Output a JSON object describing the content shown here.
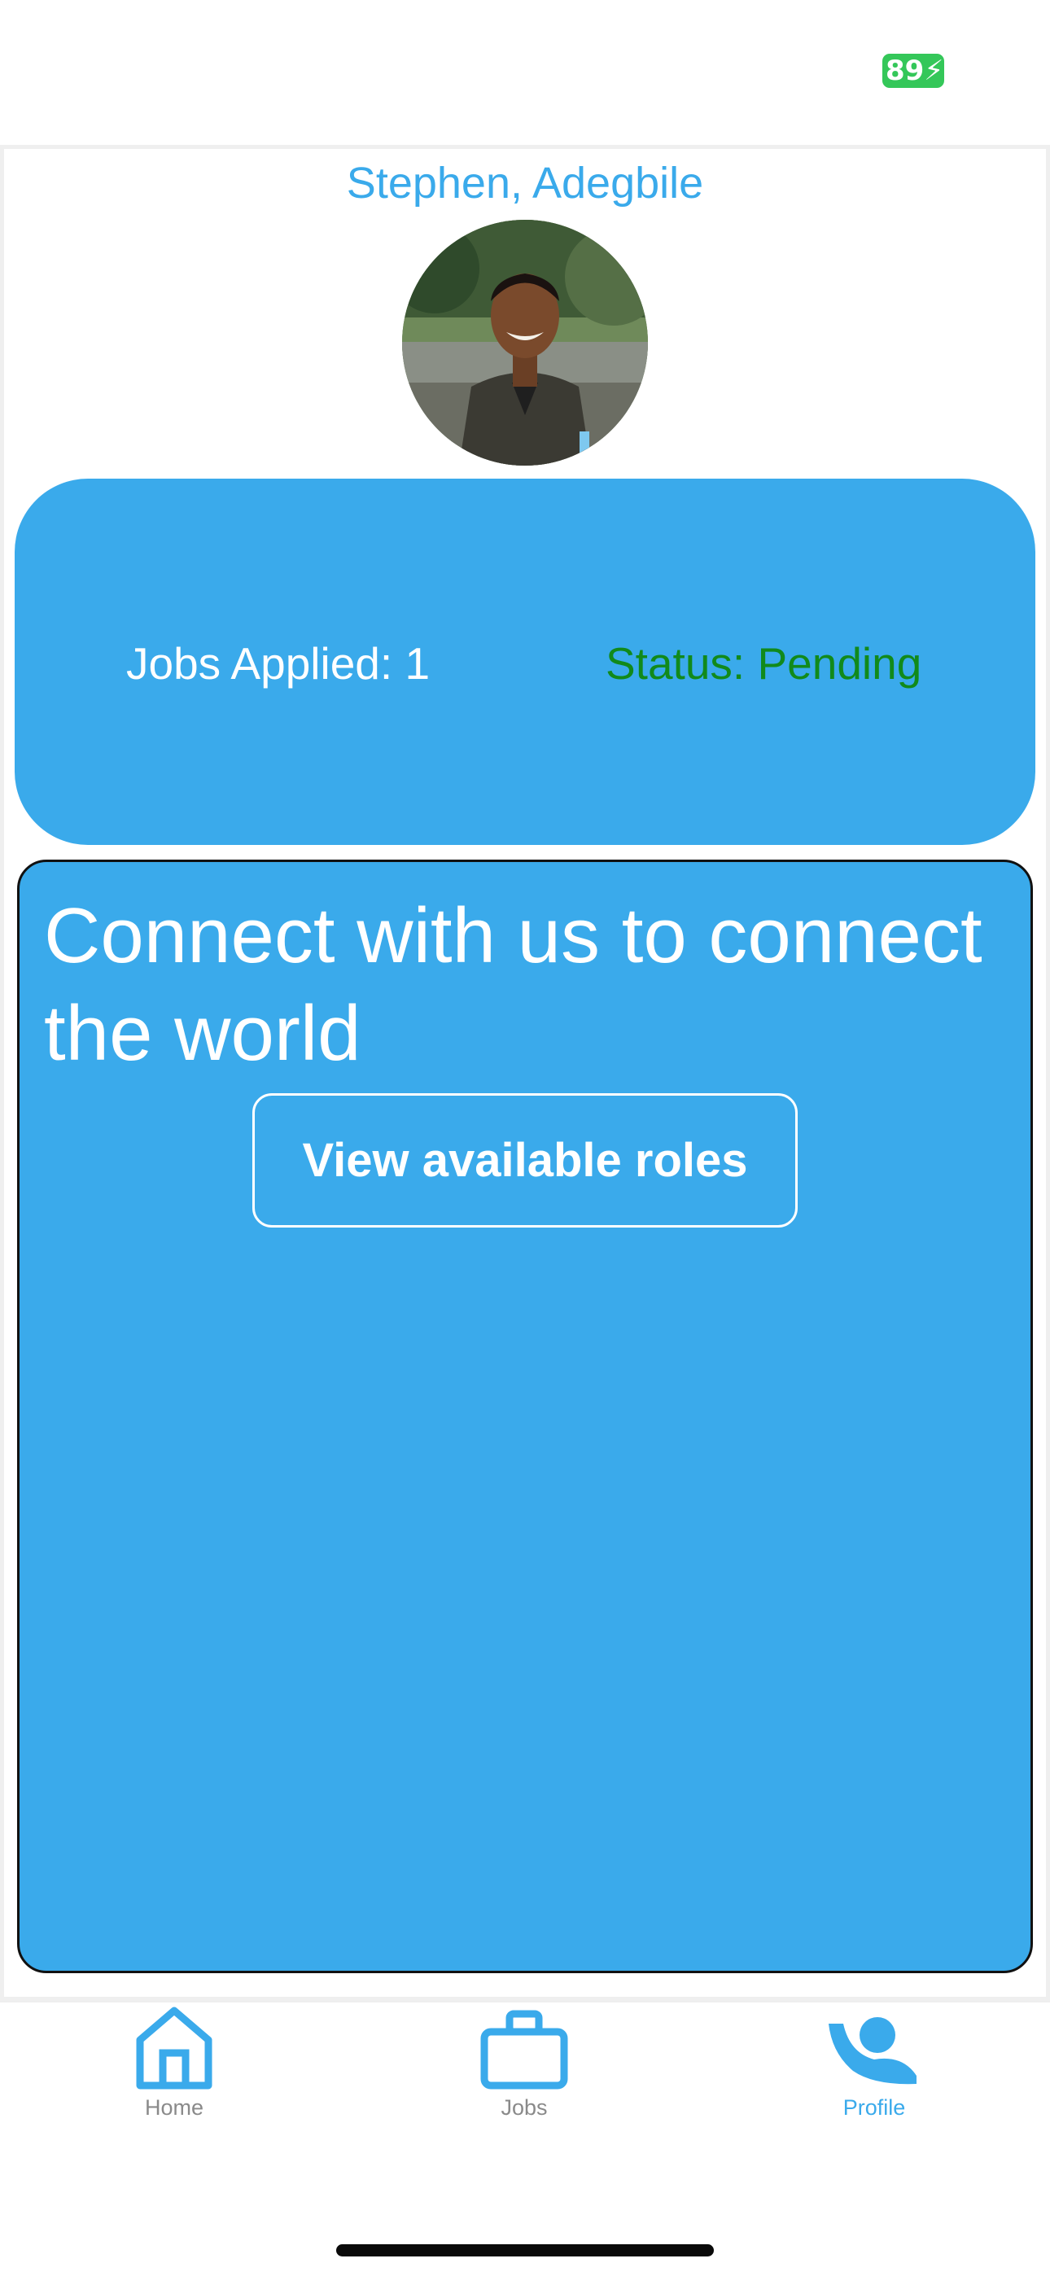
{
  "status_bar": {
    "battery_level": "89"
  },
  "profile": {
    "name": "Stephen, Adegbile",
    "avatar": "profile-photo"
  },
  "stats": {
    "jobs_applied": "Jobs Applied: 1",
    "status": "Status: Pending"
  },
  "connect": {
    "heading": "Connect with us to connect the world",
    "button_label": "View available roles"
  },
  "tab_bar": {
    "tabs": [
      {
        "label": "Home",
        "icon": "home-icon",
        "active": false
      },
      {
        "label": "Jobs",
        "icon": "briefcase-icon",
        "active": false
      },
      {
        "label": "Profile",
        "icon": "person-icon",
        "active": true
      }
    ]
  },
  "colors": {
    "accent": "#3aaaeb",
    "status_pending": "#118a1b",
    "battery": "#34c759",
    "tab_inactive_label": "#8a8a8a"
  }
}
